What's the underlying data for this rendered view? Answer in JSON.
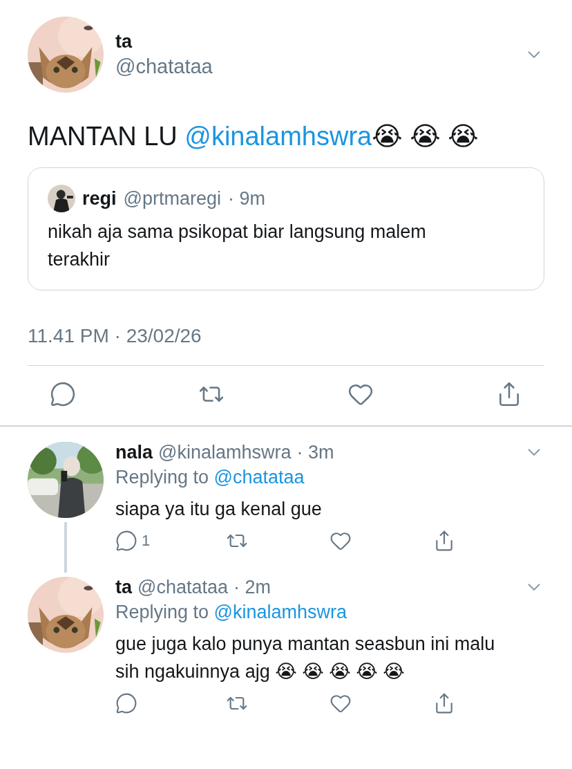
{
  "tweet": {
    "name": "ta",
    "handle": "@chatataa",
    "text": [
      {
        "kind": "plain",
        "text": "MANTAN LU "
      },
      {
        "kind": "mention",
        "text": "@kinalamhswra"
      },
      {
        "kind": "plain",
        "text": "😭 😭 😭"
      }
    ],
    "quote": {
      "name": "regi",
      "handle": "@prtmaregi",
      "time": "· 9m",
      "text": "nikah aja sama psikopat biar langsung malem terakhir"
    },
    "timestamp": "11.41 PM · 23/02/26",
    "actions": [
      {
        "kind": "reply"
      },
      {
        "kind": "retweet"
      },
      {
        "kind": "like"
      },
      {
        "kind": "share"
      }
    ]
  },
  "replies": [
    {
      "name": "nala",
      "handle": "@kinalamhswra",
      "time": "· 3m",
      "replying_to": "Replying to",
      "mention": "@chatataa",
      "text": "siapa ya itu ga kenal gue",
      "connected_below": true,
      "actions": [
        {
          "kind": "reply",
          "count": "1"
        },
        {
          "kind": "retweet"
        },
        {
          "kind": "like"
        },
        {
          "kind": "share"
        }
      ]
    },
    {
      "name": "ta",
      "handle": "@chatataa",
      "time": "· 2m",
      "replying_to": "Replying to",
      "mention": "@kinalamhswra",
      "text": "gue juga kalo punya mantan seasbun ini malu sih ngakuinnya ajg 😭 😭 😭 😭 😭",
      "connected_below": false,
      "actions": [
        {
          "kind": "reply"
        },
        {
          "kind": "retweet"
        },
        {
          "kind": "like"
        },
        {
          "kind": "share"
        }
      ]
    }
  ]
}
